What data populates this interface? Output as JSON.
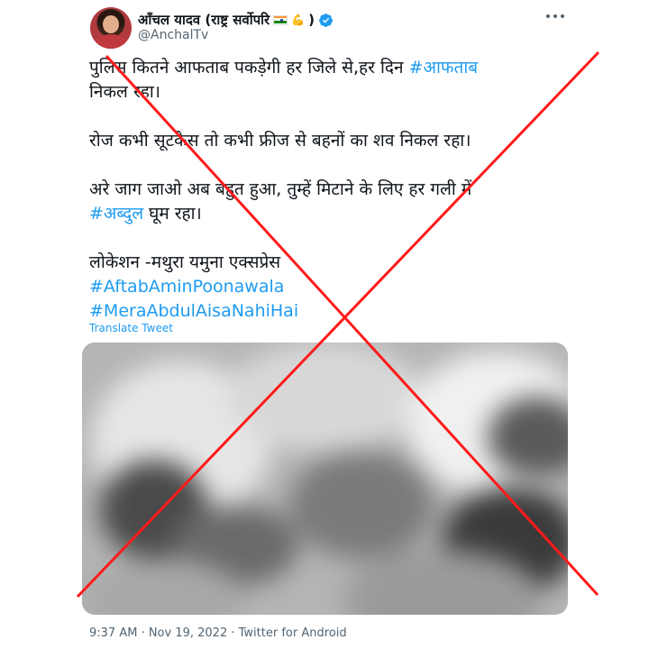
{
  "author": {
    "name": "आँचल यादव (राष्ट्र सर्वोपरि",
    "name_suffix": ")",
    "handle": "@AnchalTv",
    "verified": true
  },
  "tweet": {
    "paragraphs": [
      {
        "lines": [
          [
            {
              "text": "पुलिस कितने आफताब पकड़ेगी हर जिले से,हर दिन "
            },
            {
              "text": "#आफताब",
              "hashtag": true
            }
          ],
          [
            {
              "text": "निकल रहा।"
            }
          ]
        ]
      },
      {
        "lines": [
          [
            {
              "text": "रोज कभी सूटकेस तो कभी फ्रीज से बहनों का शव निकल रहा।"
            }
          ]
        ]
      },
      {
        "lines": [
          [
            {
              "text": "अरे जाग जाओ अब बहुत हुआ, तुम्हें मिटाने के लिए हर गली में"
            }
          ],
          [
            {
              "text": "#अब्दुल",
              "hashtag": true
            },
            {
              "text": " घूम रहा।"
            }
          ]
        ]
      },
      {
        "lines": [
          [
            {
              "text": "लोकेशन -मथुरा यमुना एक्सप्रेस"
            }
          ],
          [
            {
              "text": "#AftabAminPoonawala",
              "hashtag": true
            }
          ],
          [
            {
              "text": "#MeraAbdulAisaNahiHai",
              "hashtag": true
            }
          ]
        ]
      }
    ],
    "translate_label": "Translate Tweet",
    "meta": "9:37 AM · Nov 19, 2022 · Twitter for Android"
  },
  "icons": {
    "verified": "verified-badge-icon",
    "flag": "india-flag-icon",
    "arm": "flexed-biceps-icon",
    "more": "more-options-icon"
  },
  "colors": {
    "hashtag": "#1d9bf0",
    "cross": "#ff1a1a",
    "secondary_text": "#536471"
  }
}
